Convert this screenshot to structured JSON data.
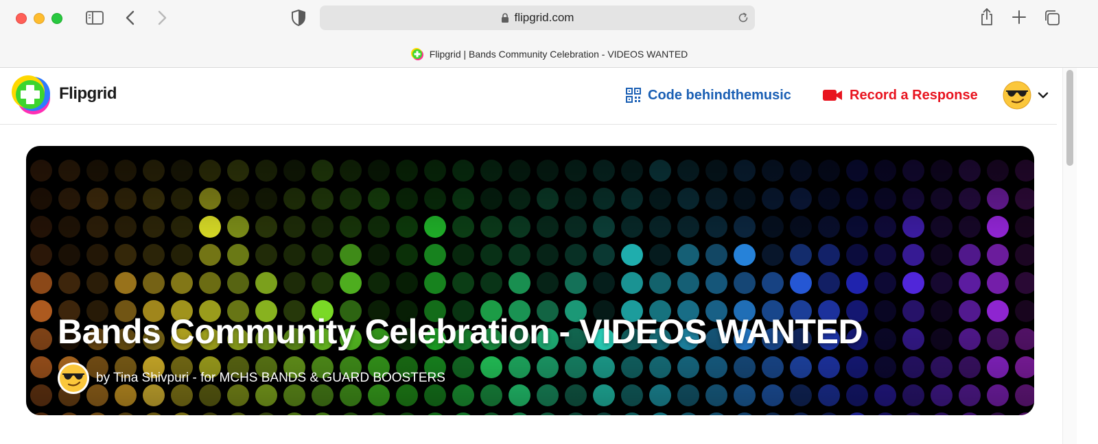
{
  "browser": {
    "url": "flipgrid.com",
    "tab_title": "Flipgrid | Bands Community Celebration - VIDEOS WANTED"
  },
  "header": {
    "logo_text": "Flipgrid",
    "code_label": "Code behindthemusic",
    "record_label": "Record a Response",
    "code_color": "#1a5fb4",
    "record_color": "#e8141f"
  },
  "topic": {
    "title": "Bands Community Celebration - VIDEOS WANTED",
    "byline": "by Tina Shivpuri - for MCHS BANDS & GUARD BOOSTERS"
  }
}
